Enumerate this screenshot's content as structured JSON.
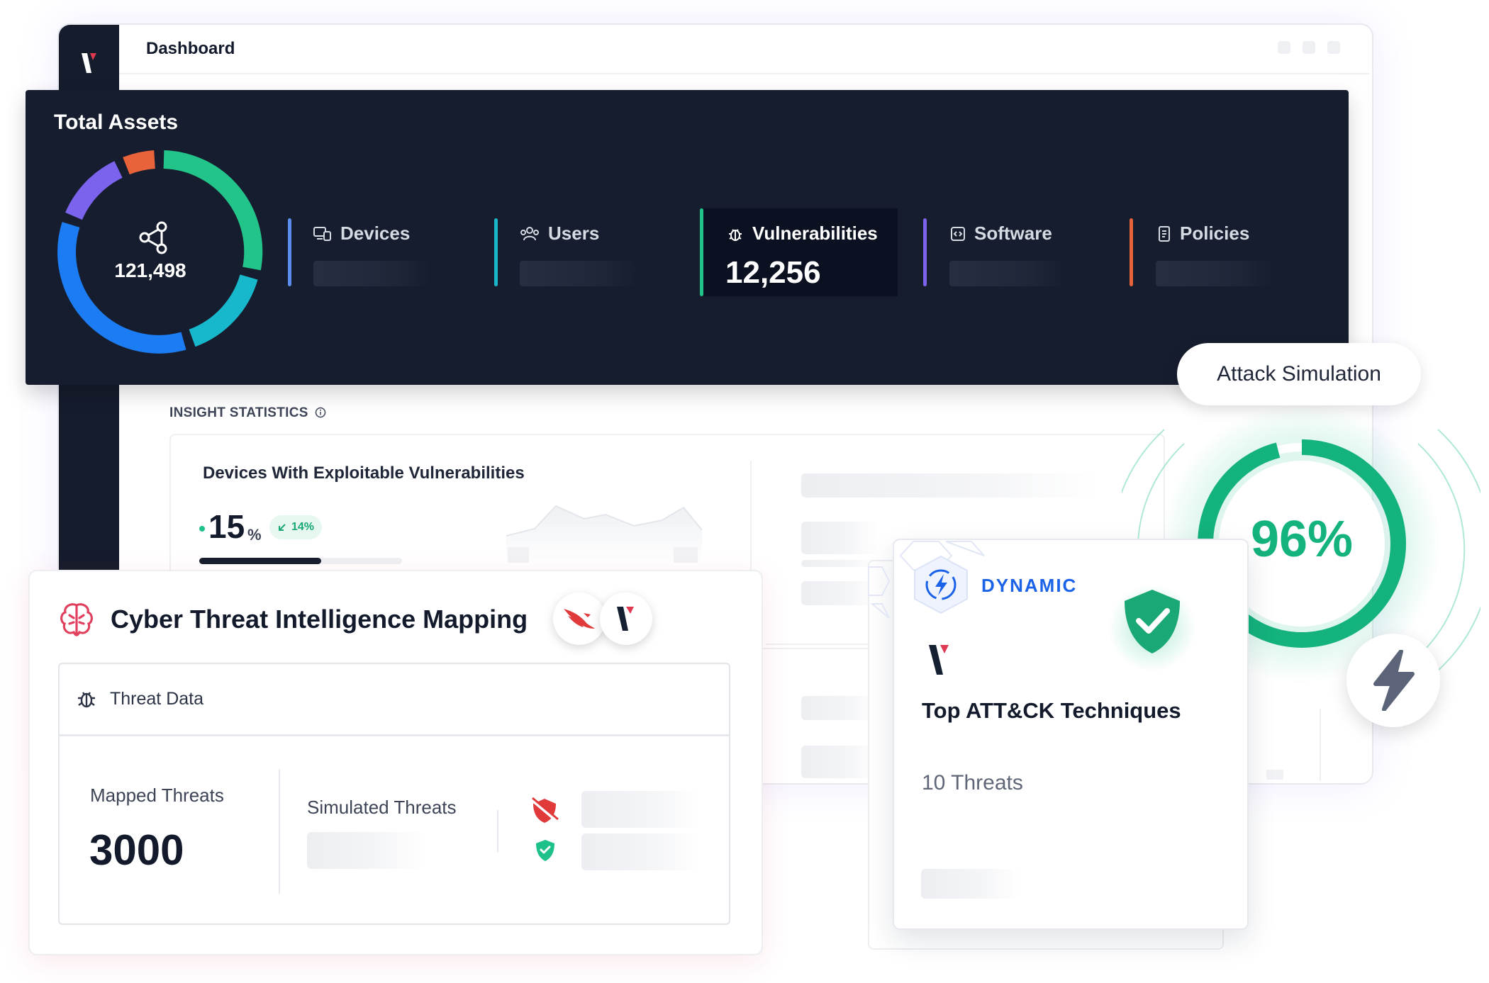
{
  "header": {
    "title": "Dashboard"
  },
  "assets": {
    "title": "Total Assets",
    "total": "121,498",
    "stats": [
      {
        "label": "Devices",
        "color": "#5b8def"
      },
      {
        "label": "Users",
        "color": "#19b5c9"
      },
      {
        "label": "Vulnerabilities",
        "value": "12,256",
        "color": "#20c48a",
        "active": true
      },
      {
        "label": "Software",
        "color": "#7b63ee"
      },
      {
        "label": "Policies",
        "color": "#e8623a"
      }
    ]
  },
  "insights": {
    "title": "INSIGHT STATISTICS",
    "devices_card": {
      "title": "Devices With Exploitable Vulnerabilities",
      "value": "15",
      "unit": "%",
      "trend": "14%",
      "progress_fraction": 0.6
    }
  },
  "attack_simulation": {
    "label": "Attack Simulation",
    "percent": "96%",
    "percent_value": 96,
    "color": "#14b27d"
  },
  "dynamic_card": {
    "badge": "DYNAMIC",
    "title": "Top ATT&CK Techniques",
    "threats": "10 Threats"
  },
  "cti_card": {
    "title": "Cyber Threat Intelligence Mapping",
    "section_label": "Threat Data",
    "mapped_label": "Mapped Threats",
    "mapped_value": "3000",
    "simulated_label": "Simulated Threats"
  },
  "icons": {
    "brand": "brand-logo-icon",
    "nodes": "nodes-icon",
    "devices": "devices-icon",
    "users": "users-icon",
    "bug": "bug-icon",
    "code": "code-icon",
    "policy": "document-icon",
    "brain": "brain-icon",
    "falcon": "falcon-icon",
    "shield_blocked": "shield-blocked-icon",
    "shield_check": "shield-check-icon",
    "bolt": "bolt-icon",
    "dynamic": "dynamic-bolt-icon",
    "info": "info-icon"
  }
}
